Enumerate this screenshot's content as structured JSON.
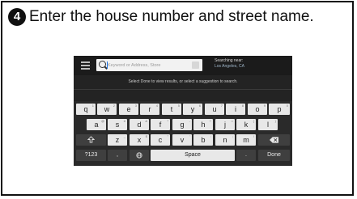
{
  "step": {
    "number": "4",
    "text": "Enter the house number and street name."
  },
  "screen": {
    "search_placeholder": "Keyword or Address, Store",
    "near_label": "Searching near:",
    "near_value": "Los Angeles, CA",
    "hint": "Select Done to view results, or select a suggestion to search."
  },
  "keyboard": {
    "row1": [
      {
        "label": "q",
        "alt": "1"
      },
      {
        "label": "w",
        "alt": "2"
      },
      {
        "label": "e",
        "alt": "3"
      },
      {
        "label": "r",
        "alt": "4"
      },
      {
        "label": "t",
        "alt": "5"
      },
      {
        "label": "y",
        "alt": "6"
      },
      {
        "label": "u",
        "alt": "7"
      },
      {
        "label": "i",
        "alt": "8"
      },
      {
        "label": "o",
        "alt": "9"
      },
      {
        "label": "p",
        "alt": "0"
      }
    ],
    "row2": [
      {
        "label": "a",
        "alt": "@"
      },
      {
        "label": "s",
        "alt": "#"
      },
      {
        "label": "d",
        "alt": "&"
      },
      {
        "label": "f",
        "alt": "*"
      },
      {
        "label": "g",
        "alt": "-"
      },
      {
        "label": "h",
        "alt": "+"
      },
      {
        "label": "j",
        "alt": "="
      },
      {
        "label": "k",
        "alt": "("
      },
      {
        "label": "l",
        "alt": ")"
      }
    ],
    "row3": [
      {
        "label": "z",
        "alt": "_"
      },
      {
        "label": "x",
        "alt": "$"
      },
      {
        "label": "c",
        "alt": "\""
      },
      {
        "label": "v",
        "alt": "'"
      },
      {
        "label": "b",
        "alt": ":"
      },
      {
        "label": "n",
        "alt": ";"
      },
      {
        "label": "m",
        "alt": "/"
      }
    ],
    "shift_icon": "shift-arrow-icon",
    "backspace_icon": "backspace-icon",
    "symbols_label": "?123",
    "comma_label": ",",
    "globe_icon": "globe-icon",
    "space_label": "Space",
    "period_label": ".",
    "done_label": "Done"
  }
}
